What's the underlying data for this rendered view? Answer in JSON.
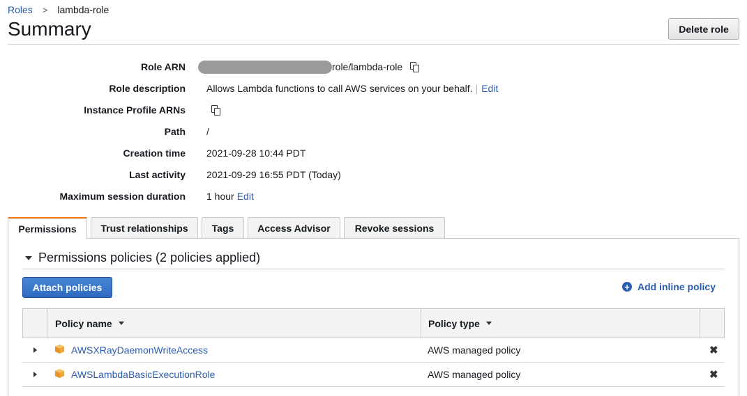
{
  "breadcrumb": {
    "parent": "Roles",
    "separator": ">",
    "current": "lambda-role"
  },
  "title": "Summary",
  "delete_button": "Delete role",
  "details": {
    "role_arn": {
      "label": "Role ARN",
      "value_suffix": "role/lambda-role"
    },
    "role_description": {
      "label": "Role description",
      "value": "Allows Lambda functions to call AWS services on your behalf.",
      "separator": "|",
      "edit": "Edit"
    },
    "instance_profile_arns": {
      "label": "Instance Profile ARNs"
    },
    "path": {
      "label": "Path",
      "value": "/"
    },
    "creation_time": {
      "label": "Creation time",
      "value": "2021-09-28 10:44 PDT"
    },
    "last_activity": {
      "label": "Last activity",
      "value": "2021-09-29 16:55 PDT (Today)"
    },
    "max_session": {
      "label": "Maximum session duration",
      "value": "1 hour",
      "edit": "Edit"
    }
  },
  "tabs": [
    {
      "label": "Permissions",
      "active": true
    },
    {
      "label": "Trust relationships",
      "active": false
    },
    {
      "label": "Tags",
      "active": false
    },
    {
      "label": "Access Advisor",
      "active": false
    },
    {
      "label": "Revoke sessions",
      "active": false
    }
  ],
  "permissions": {
    "section_title": "Permissions policies (2 policies applied)",
    "attach_button": "Attach policies",
    "add_inline": "Add inline policy",
    "columns": {
      "policy_name": "Policy name",
      "policy_type": "Policy type"
    },
    "rows": [
      {
        "name": "AWSXRayDaemonWriteAccess",
        "type": "AWS managed policy"
      },
      {
        "name": "AWSLambdaBasicExecutionRole",
        "type": "AWS managed policy"
      }
    ]
  },
  "colors": {
    "link": "#2a5db0",
    "tab_accent": "#ec7211",
    "primary_button": "#2e6bc1",
    "policy_icon": "#f0a732"
  },
  "icons": {
    "copy": "copy-icon",
    "plus": "plus-circle-icon",
    "policy": "aws-policy-box-icon",
    "remove": "close-icon"
  }
}
